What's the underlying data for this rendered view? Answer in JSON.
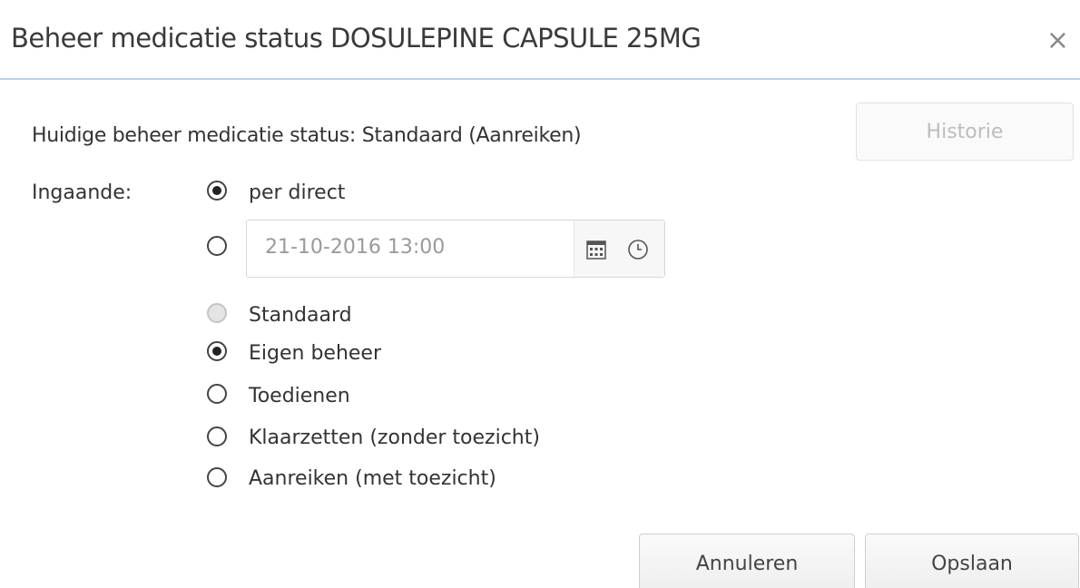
{
  "dialog": {
    "title": "Beheer medicatie status DOSULEPINE CAPSULE 25MG",
    "close_glyph": "×"
  },
  "status": {
    "current_text": "Huidige beheer medicatie status: Standaard (Aanreiken)",
    "history_button": "Historie"
  },
  "ingaande": {
    "label": "Ingaande:",
    "options": [
      {
        "label": "per direct",
        "checked": true
      },
      {
        "label": "",
        "checked": false
      }
    ],
    "date_value": "21-10-2016 13:00",
    "icons": [
      "calendar-icon",
      "clock-icon"
    ]
  },
  "beheer": {
    "options": [
      {
        "label": "Standaard",
        "checked": false,
        "disabled": true
      },
      {
        "label": "Eigen beheer",
        "checked": true,
        "disabled": false
      },
      {
        "label": "Toedienen",
        "checked": false,
        "disabled": false
      },
      {
        "label": "Klaarzetten (zonder toezicht)",
        "checked": false,
        "disabled": false
      },
      {
        "label": "Aanreiken (met toezicht)",
        "checked": false,
        "disabled": false
      }
    ]
  },
  "footer": {
    "cancel_label": "Annuleren",
    "save_label": "Opslaan"
  }
}
